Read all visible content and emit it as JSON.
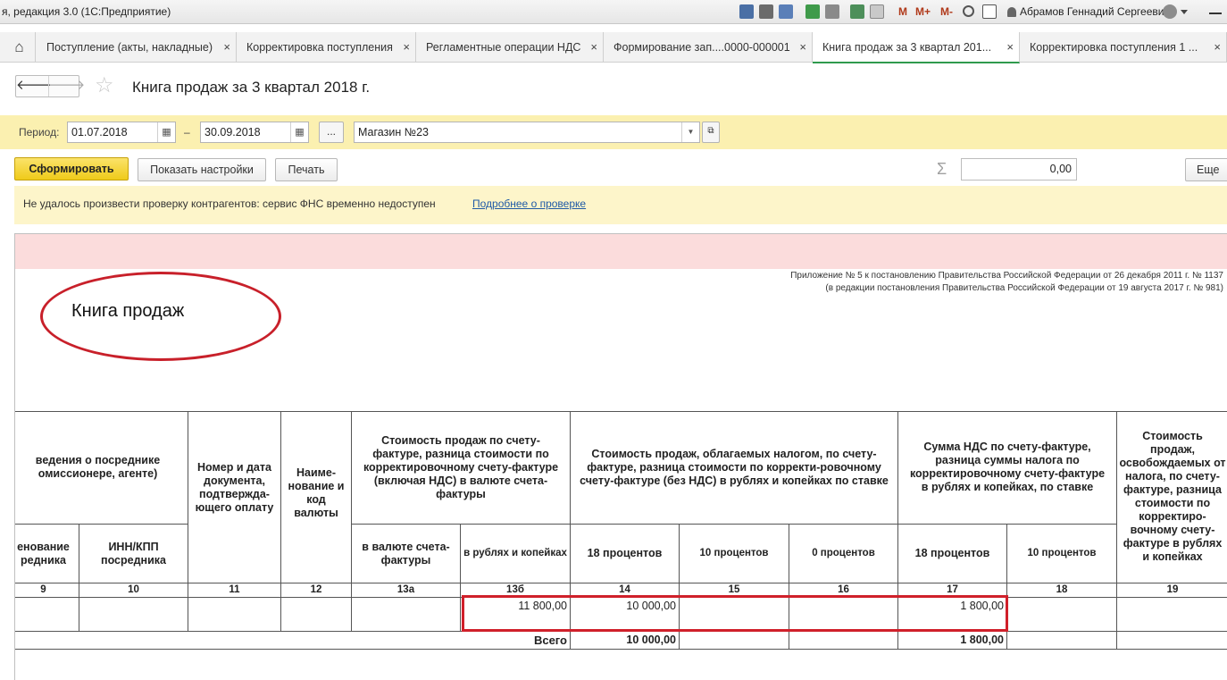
{
  "titlebar": {
    "app_title": "я, редакция 3.0  (1С:Предприятие)",
    "m1": "M",
    "m2": "M+",
    "m3": "M-",
    "user": "Абрамов Геннадий Сергеевич"
  },
  "tabs": [
    {
      "label": "Поступление (акты, накладные)"
    },
    {
      "label": "Корректировка поступления"
    },
    {
      "label": "Регламентные операции НДС"
    },
    {
      "label": "Формирование зап....0000-000001"
    },
    {
      "label": "Книга продаж за 3 квартал 201..."
    },
    {
      "label": "Корректировка поступления 1 ..."
    }
  ],
  "tab_close": "×",
  "header": {
    "title": "Книга продаж за 3 квартал 2018 г."
  },
  "filter": {
    "period_label": "Период:",
    "date_from": "01.07.2018",
    "dash": "–",
    "date_to": "30.09.2018",
    "ellipsis": "...",
    "organization": "Магазин №23"
  },
  "actions": {
    "generate": "Сформировать",
    "show_settings": "Показать настройки",
    "print": "Печать",
    "sum_value": "0,00",
    "more": "Еще"
  },
  "warning": {
    "text": "Не удалось произвести проверку контрагентов: сервис ФНС временно недоступен",
    "link": "Подробнее о проверке"
  },
  "report": {
    "appendix_line1": "Приложение № 5 к постановлению Правительства Российской Федерации от 26 декабря 2011 г. № 1137",
    "appendix_line2": "(в редакции постановления Правительства Российской Федерации от 19 августа 2017 г. № 981)",
    "title": "Книга продаж",
    "headers": {
      "intermediary": "ведения о посреднике омиссионере, агенте)",
      "payment_doc": "Номер и дата документа, подтвержда-ющего оплату",
      "currency": "Наиме-нование и код валюты",
      "cost_incl_vat": "Стоимость продаж по счету-фактуре, разница стоимости по корректировочному счету-фактуре (включая НДС) в валюте счета-фактуры",
      "cost_taxable": "Стоимость продаж, облагаемых налогом, по счету-фактуре, разница стоимости по корректи-ровочному счету-фактуре (без НДС) в рублях и копейках по ставке",
      "vat_sum": "Сумма НДС по счету-фактуре, разница суммы налога по корректировочному счету-фактуре в рублях и копейках, по ставке",
      "exempt": "Стоимость продаж, освобождаемых от налога, по счету-фактуре, разница стоимости по корректиро-вочному счету-фактуре в рублях и копейках"
    },
    "subheaders": {
      "interm_name": "енование редника",
      "interm_inn": "ИНН/КПП посредника",
      "in_currency": "в валюте счета-фактуры",
      "in_rub": "в рублях и копейках",
      "r18": "18 процентов",
      "r10": "10 процентов",
      "r0": "0 процентов",
      "v18": "18 процентов",
      "v10": "10 процентов"
    },
    "col_numbers": [
      "9",
      "10",
      "11",
      "12",
      "13а",
      "13б",
      "14",
      "15",
      "16",
      "17",
      "18",
      "19"
    ],
    "row": {
      "c13b": "11 800,00",
      "c14": "10 000,00",
      "c17": "1 800,00"
    },
    "total": {
      "label": "Всего",
      "c14": "10 000,00",
      "c17": "1 800,00"
    }
  }
}
